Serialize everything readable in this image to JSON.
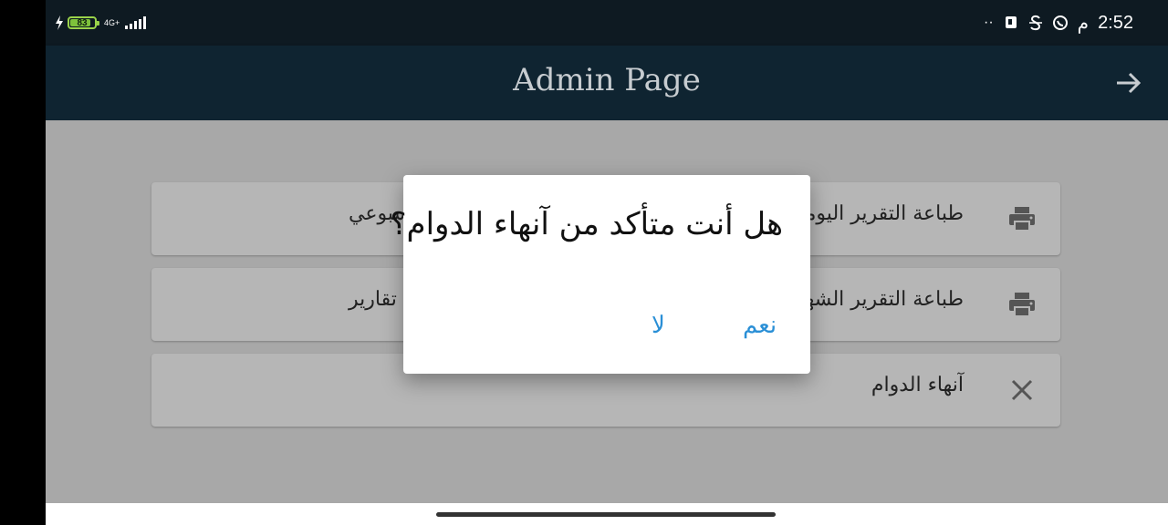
{
  "status_bar": {
    "battery_level": "83",
    "network_type": "4G+",
    "time": "2:52",
    "am_pm": "م",
    "icons": [
      "charging-icon",
      "battery-icon",
      "signal-icon",
      "more-dots-icon",
      "notification-icon",
      "strikethrough-s-icon",
      "whatsapp-icon"
    ]
  },
  "app_bar": {
    "title": "Admin Page",
    "back_icon": "arrow-right-icon"
  },
  "cards": [
    {
      "label": "طباعة التقرير اليومي",
      "secondary_label": "لاسبوعي",
      "icon": "printer-icon"
    },
    {
      "label": "طباعة التقرير الشهري",
      "secondary_label": "تقارير",
      "icon": "printer-icon"
    },
    {
      "label": "آنهاء الدوام",
      "secondary_label": "",
      "icon": "close-icon"
    }
  ],
  "dialog": {
    "question": "هل أنت متأكد من آنهاء الدوام؟",
    "yes_label": "نعم",
    "no_label": "لا"
  },
  "colors": {
    "app_bar": "#0f2431",
    "status_bar": "#0e1a22",
    "dialog_button": "#2a8fd6",
    "overlay_background": "#a8a8a8"
  }
}
